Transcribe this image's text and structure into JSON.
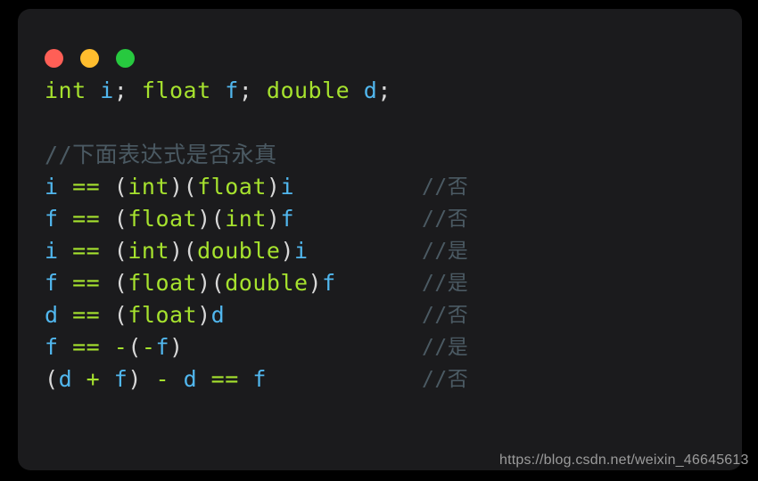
{
  "window": {
    "background_color": "#1b1b1d",
    "page_background_color": "#000000",
    "traffic_lights": [
      {
        "name": "close",
        "color": "#ff5f56",
        "label": "close"
      },
      {
        "name": "minimize",
        "color": "#ffbd2e",
        "label": "minimize"
      },
      {
        "name": "maximize",
        "color": "#27c93f",
        "label": "maximize"
      }
    ]
  },
  "theme": {
    "keyword_color": "#a6e22e",
    "variable_color": "#51b7ee",
    "punctuation_color": "#d8d8d8",
    "operator_color": "#a6e22e",
    "comment_color": "#4b5a63"
  },
  "code": {
    "language": "c",
    "declaration": {
      "kw_int": "int",
      "var_i": "i",
      "semi_1": "; ",
      "kw_float": "float",
      "var_f": "f",
      "semi_2": "; ",
      "kw_double": "double",
      "var_d": "d",
      "semi_3": ";",
      "space": " "
    },
    "section_comment": "//下面表达式是否永真",
    "expressions": [
      {
        "lhs_var": "i",
        "op": " == ",
        "open1": "(",
        "cast1": "int",
        "close1": ")",
        "open2": "(",
        "cast2": "float",
        "close2": ")",
        "rhs_var": "i",
        "comment": "//否",
        "plain": "i == (int)(float)i",
        "answer": "否"
      },
      {
        "lhs_var": "f",
        "op": " == ",
        "open1": "(",
        "cast1": "float",
        "close1": ")",
        "open2": "(",
        "cast2": "int",
        "close2": ")",
        "rhs_var": "f",
        "comment": "//否",
        "plain": "f == (float)(int)f",
        "answer": "否"
      },
      {
        "lhs_var": "i",
        "op": " == ",
        "open1": "(",
        "cast1": "int",
        "close1": ")",
        "open2": "(",
        "cast2": "double",
        "close2": ")",
        "rhs_var": "i",
        "comment": "//是",
        "plain": "i == (int)(double)i",
        "answer": "是"
      },
      {
        "lhs_var": "f",
        "op": " == ",
        "open1": "(",
        "cast1": "float",
        "close1": ")",
        "open2": "(",
        "cast2": "double",
        "close2": ")",
        "rhs_var": "f",
        "comment": "//是",
        "plain": "f == (float)(double)f",
        "answer": "是"
      },
      {
        "lhs_var": "d",
        "op": " == ",
        "open1": "(",
        "cast1": "float",
        "close1": ")",
        "open2": "",
        "cast2": "",
        "close2": "",
        "rhs_var": "d",
        "comment": "//否",
        "plain": "d == (float)d",
        "answer": "否"
      }
    ],
    "negation_line": {
      "lhs_var": "f",
      "op": " == ",
      "minus_outer": "-",
      "open": "(",
      "minus_inner": "-",
      "inner_var": "f",
      "close": ")",
      "comment": "//是",
      "plain": "f == -(-f)",
      "answer": "是"
    },
    "arith_line": {
      "open": "(",
      "var_d1": "d",
      "plus": " + ",
      "var_f1": "f",
      "close": ")",
      "minus": " - ",
      "var_d2": "d",
      "eq": " == ",
      "var_f2": "f",
      "comment": "//否",
      "plain": "(d + f) - d == f",
      "answer": "否"
    }
  },
  "watermark": {
    "text": "https://blog.csdn.net/weixin_46645613"
  }
}
